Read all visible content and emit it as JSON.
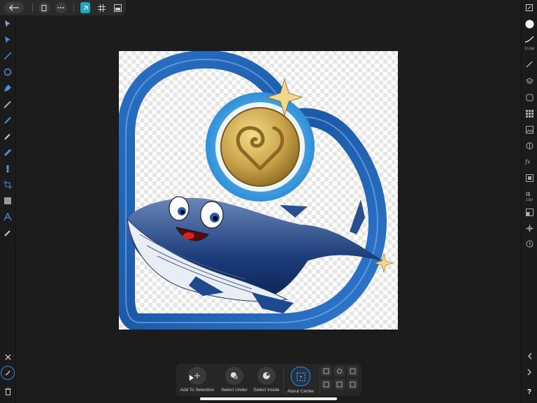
{
  "context_bar": {
    "items": [
      {
        "label": "Add To Selection"
      },
      {
        "label": "Select Under"
      },
      {
        "label": "Select Inside"
      },
      {
        "label": "About Center"
      }
    ]
  },
  "right_panel": {
    "brush_size": "10.0pt",
    "font_size": "12pt",
    "help_label": "?"
  },
  "colors": {
    "accent": "#2f8fd8",
    "heart_blue": "#1f5fb0",
    "coin_gold": "#c9a24a"
  }
}
